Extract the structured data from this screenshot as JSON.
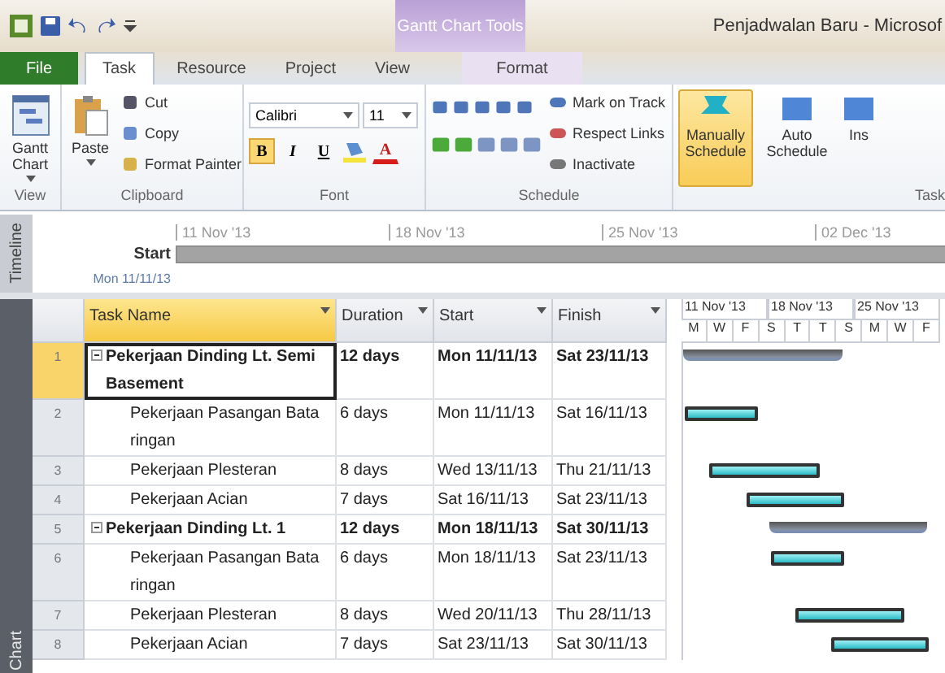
{
  "title_bar": {
    "context_tab": "Gantt Chart Tools",
    "title": "Penjadwalan Baru - Microsof"
  },
  "tabs": [
    {
      "label": "File",
      "kind": "file",
      "selected": false
    },
    {
      "label": "Task",
      "kind": "normal",
      "selected": true
    },
    {
      "label": "Resource",
      "kind": "normal",
      "selected": false
    },
    {
      "label": "Project",
      "kind": "normal",
      "selected": false
    },
    {
      "label": "View",
      "kind": "normal",
      "selected": false
    },
    {
      "label": "Format",
      "kind": "context",
      "selected": false
    }
  ],
  "ribbon": {
    "view_group": {
      "label": "View",
      "button": "Gantt Chart"
    },
    "clipboard": {
      "label": "Clipboard",
      "paste": "Paste",
      "items": [
        "Cut",
        "Copy",
        "Format Painter"
      ]
    },
    "font": {
      "label": "Font",
      "family": "Calibri",
      "size": "11",
      "styles": [
        {
          "label": "B",
          "on": true
        },
        {
          "label": "I",
          "on": false
        },
        {
          "label": "U",
          "on": false
        }
      ],
      "color_letter": "A"
    },
    "schedule": {
      "label": "Schedule",
      "items": [
        "Mark on Track",
        "Respect Links",
        "Inactivate"
      ]
    },
    "tasks": {
      "label": "Task",
      "buttons": [
        {
          "label": "Manually Schedule",
          "selected": true
        },
        {
          "label": "Auto Schedule",
          "selected": false
        },
        {
          "label": "Ins",
          "selected": false
        }
      ]
    }
  },
  "timeline": {
    "label": "Timeline",
    "ticks": [
      "11 Nov '13",
      "18 Nov '13",
      "25 Nov '13",
      "02 Dec '13"
    ],
    "start_label": "Start",
    "start_date": "Mon 11/11/13"
  },
  "side_label": "Chart",
  "table": {
    "columns": [
      "Task Name",
      "Duration",
      "Start",
      "Finish"
    ],
    "rows": [
      {
        "id": "1",
        "name": "Pekerjaan Dinding Lt. Semi Basement",
        "duration": "12 days",
        "start": "Mon 11/11/13",
        "finish": "Sat 23/11/13",
        "kind": "summary",
        "selected": true
      },
      {
        "id": "2",
        "name": "Pekerjaan Pasangan Bata ringan",
        "duration": "6 days",
        "start": "Mon 11/11/13",
        "finish": "Sat 16/11/13",
        "kind": "task",
        "selected": false
      },
      {
        "id": "3",
        "name": "Pekerjaan Plesteran",
        "duration": "8 days",
        "start": "Wed 13/11/13",
        "finish": "Thu 21/11/13",
        "kind": "task",
        "selected": false
      },
      {
        "id": "4",
        "name": "Pekerjaan Acian",
        "duration": "7 days",
        "start": "Sat 16/11/13",
        "finish": "Sat 23/11/13",
        "kind": "task",
        "selected": false
      },
      {
        "id": "5",
        "name": "Pekerjaan Dinding Lt. 1",
        "duration": "12 days",
        "start": "Mon 18/11/13",
        "finish": "Sat 30/11/13",
        "kind": "summary",
        "selected": false
      },
      {
        "id": "6",
        "name": "Pekerjaan Pasangan Bata ringan",
        "duration": "6 days",
        "start": "Mon 18/11/13",
        "finish": "Sat 23/11/13",
        "kind": "task",
        "selected": false
      },
      {
        "id": "7",
        "name": "Pekerjaan Plesteran",
        "duration": "8 days",
        "start": "Wed 20/11/13",
        "finish": "Thu 28/11/13",
        "kind": "task",
        "selected": false
      },
      {
        "id": "8",
        "name": "Pekerjaan Acian",
        "duration": "7 days",
        "start": "Sat 23/11/13",
        "finish": "Sat 30/11/13",
        "kind": "task",
        "selected": false
      }
    ]
  },
  "gantt": {
    "weeks": [
      "11 Nov '13",
      "18 Nov '13",
      "25 Nov '13"
    ],
    "days": [
      "M",
      "W",
      "F",
      "S",
      "T",
      "T",
      "S",
      "M",
      "W",
      "F"
    ]
  }
}
